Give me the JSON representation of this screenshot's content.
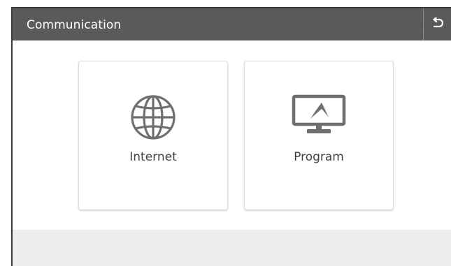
{
  "header": {
    "title": "Communication",
    "back_icon": "back-arrow-icon"
  },
  "tiles": [
    {
      "label": "Internet",
      "icon": "globe-icon"
    },
    {
      "label": "Program",
      "icon": "monitor-icon"
    }
  ],
  "colors": {
    "header_bg": "#585858",
    "icon_gray": "#6f6f6f",
    "label_text": "#444444",
    "footer_bg": "#eeeeee"
  }
}
